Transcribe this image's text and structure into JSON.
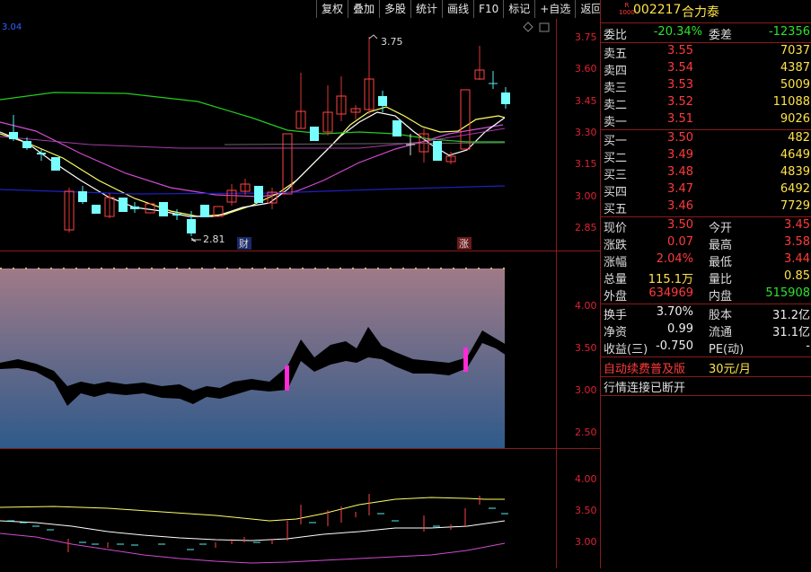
{
  "toolbar": [
    "复权",
    "叠加",
    "多股",
    "统计",
    "画线",
    "F10",
    "标记",
    "+自选",
    "返回"
  ],
  "top_left_value": "3.04",
  "main_chart": {
    "high_marker": "3.75",
    "low_marker": "2.81",
    "badge_fin": "财",
    "badge_up": "涨",
    "axis": [
      "3.75",
      "3.60",
      "3.45",
      "3.30",
      "3.15",
      "3.00",
      "2.85"
    ]
  },
  "mid_chart": {
    "axis": [
      "4.00",
      "3.50",
      "3.00",
      "2.50"
    ]
  },
  "bottom_chart": {
    "axis": [
      "4.00",
      "3.50",
      "3.00"
    ]
  },
  "stock": {
    "badge_top": "R",
    "badge_bottom": "1000",
    "code": "002217",
    "name": "合力泰"
  },
  "book": {
    "ratio_label": "委比",
    "ratio_value": "-20.34%",
    "diff_label": "委差",
    "diff_value": "-12356",
    "asks": [
      {
        "label": "卖五",
        "price": "3.55",
        "vol": "7037"
      },
      {
        "label": "卖四",
        "price": "3.54",
        "vol": "4387"
      },
      {
        "label": "卖三",
        "price": "3.53",
        "vol": "5009"
      },
      {
        "label": "卖二",
        "price": "3.52",
        "vol": "11088"
      },
      {
        "label": "卖一",
        "price": "3.51",
        "vol": "9026"
      }
    ],
    "bids": [
      {
        "label": "买一",
        "price": "3.50",
        "vol": "482"
      },
      {
        "label": "买二",
        "price": "3.49",
        "vol": "4649"
      },
      {
        "label": "买三",
        "price": "3.48",
        "vol": "4839"
      },
      {
        "label": "买四",
        "price": "3.47",
        "vol": "6492"
      },
      {
        "label": "买五",
        "price": "3.46",
        "vol": "7729"
      }
    ]
  },
  "stats": [
    {
      "l1": "现价",
      "v1": "3.50",
      "c1": "red",
      "l2": "今开",
      "v2": "3.45",
      "c2": "red"
    },
    {
      "l1": "涨跌",
      "v1": "0.07",
      "c1": "red",
      "l2": "最高",
      "v2": "3.58",
      "c2": "red"
    },
    {
      "l1": "涨幅",
      "v1": "2.04%",
      "c1": "red",
      "l2": "最低",
      "v2": "3.44",
      "c2": "red"
    },
    {
      "l1": "总量",
      "v1": "115.1万",
      "c1": "yellow",
      "l2": "量比",
      "v2": "0.85",
      "c2": "yellow"
    },
    {
      "l1": "外盘",
      "v1": "634969",
      "c1": "red",
      "l2": "内盘",
      "v2": "515908",
      "c2": "green"
    }
  ],
  "stats2": [
    {
      "l1": "换手",
      "v1": "3.70%",
      "c1": "white",
      "l2": "股本",
      "v2": "31.2亿",
      "c2": "white"
    },
    {
      "l1": "净资",
      "v1": "0.99",
      "c1": "white",
      "l2": "流通",
      "v2": "31.1亿",
      "c2": "white"
    },
    {
      "l1": "收益(三)",
      "v1": "-0.750",
      "c1": "white",
      "l2": "PE(动)",
      "v2": "-",
      "c2": "white"
    }
  ],
  "promo": {
    "text": "自动续费普及版",
    "price": "30元/月"
  },
  "status": "行情连接已断开"
}
